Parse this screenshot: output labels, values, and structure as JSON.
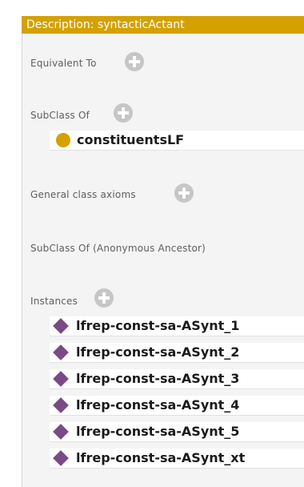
{
  "header": {
    "title": "Description: syntacticActant"
  },
  "colors": {
    "header_bg": "#d4a100",
    "class_dot": "#d4a100",
    "instance_diamond": "#7b4a86",
    "panel_bg": "#f4f4f4"
  },
  "sections": {
    "equivalent_to": "Equivalent To",
    "subclass_of": "SubClass Of",
    "general_axioms": "General class axioms",
    "anon_ancestor": "SubClass Of (Anonymous Ancestor)",
    "instances": "Instances"
  },
  "subclass_items": [
    {
      "label": "constituentsLF",
      "icon": "class-circle-icon"
    }
  ],
  "instances": [
    {
      "label": "lfrep-const-sa-ASynt_1",
      "icon": "individual-diamond-icon"
    },
    {
      "label": "lfrep-const-sa-ASynt_2",
      "icon": "individual-diamond-icon"
    },
    {
      "label": "lfrep-const-sa-ASynt_3",
      "icon": "individual-diamond-icon"
    },
    {
      "label": "lfrep-const-sa-ASynt_4",
      "icon": "individual-diamond-icon"
    },
    {
      "label": "lfrep-const-sa-ASynt_5",
      "icon": "individual-diamond-icon"
    },
    {
      "label": "lfrep-const-sa-ASynt_xt",
      "icon": "individual-diamond-icon"
    }
  ]
}
